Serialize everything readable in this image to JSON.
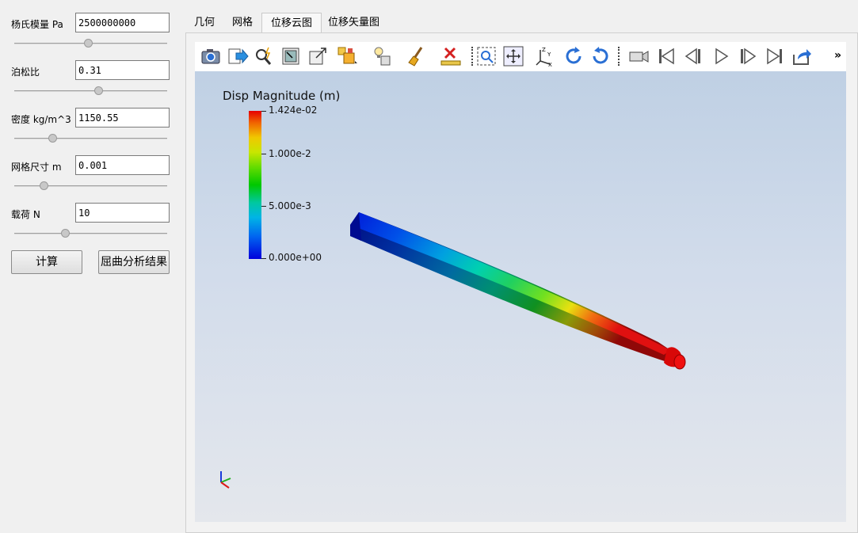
{
  "params": [
    {
      "label": "杨氏模量 Pa",
      "value": "2500000000",
      "slider": 0.48
    },
    {
      "label": "泊松比",
      "value": "0.31",
      "slider": 0.55
    },
    {
      "label": "密度 kg/m^3",
      "value": "1150.55",
      "slider": 0.25
    },
    {
      "label": "网格尺寸 m",
      "value": "0.001",
      "slider": 0.19
    },
    {
      "label": "载荷 N",
      "value": "10",
      "slider": 0.33
    }
  ],
  "buttons": {
    "compute": "计算",
    "buckling": "屈曲分析结果"
  },
  "tabs": [
    "几何",
    "网格",
    "位移云图",
    "位移矢量图"
  ],
  "active_tab": "位移云图",
  "toolbar": {
    "icons": [
      "camera-icon",
      "save-data-icon",
      "find-data-icon",
      "select-cells-icon",
      "resize-view-icon",
      "representation-icon",
      "light-icon",
      "clear-icon",
      "ruler-icon",
      "zoom-box-icon",
      "reset-camera-icon",
      "axes-icon",
      "rotate-cw-icon",
      "rotate-ccw-icon",
      "video-camera-icon",
      "first-frame-icon",
      "previous-frame-icon",
      "play-icon",
      "next-frame-icon",
      "last-frame-icon",
      "export-icon"
    ],
    "more": "»"
  },
  "legend": {
    "title": "Disp Magnitude (m)",
    "labels": [
      "1.424e-02",
      "1.000e-2",
      "5.000e-3",
      "0.000e+00"
    ],
    "colors": {
      "max": "#e60000",
      "mid": "#00c800",
      "min": "#0000dc"
    }
  }
}
